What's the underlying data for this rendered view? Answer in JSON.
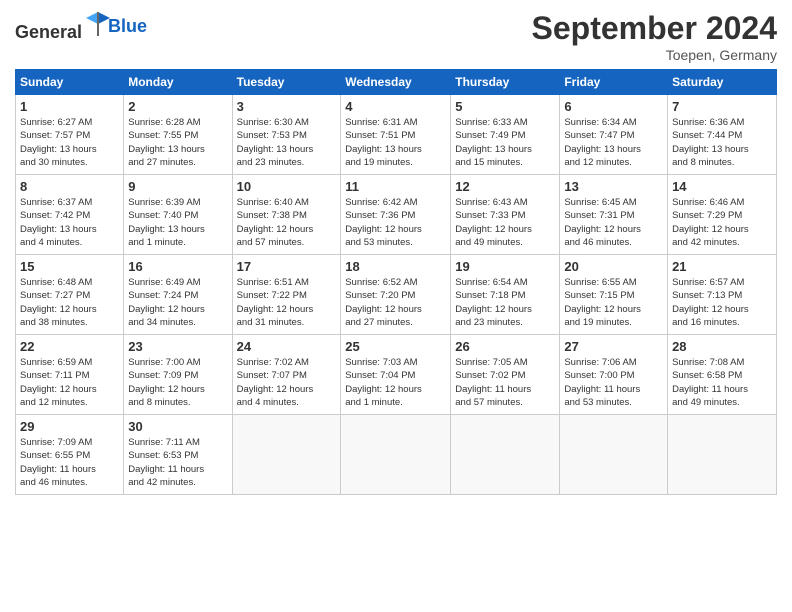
{
  "header": {
    "logo_general": "General",
    "logo_blue": "Blue",
    "title": "September 2024",
    "location": "Toepen, Germany"
  },
  "columns": [
    "Sunday",
    "Monday",
    "Tuesday",
    "Wednesday",
    "Thursday",
    "Friday",
    "Saturday"
  ],
  "weeks": [
    [
      {
        "day": "1",
        "info": "Sunrise: 6:27 AM\nSunset: 7:57 PM\nDaylight: 13 hours\nand 30 minutes."
      },
      {
        "day": "2",
        "info": "Sunrise: 6:28 AM\nSunset: 7:55 PM\nDaylight: 13 hours\nand 27 minutes."
      },
      {
        "day": "3",
        "info": "Sunrise: 6:30 AM\nSunset: 7:53 PM\nDaylight: 13 hours\nand 23 minutes."
      },
      {
        "day": "4",
        "info": "Sunrise: 6:31 AM\nSunset: 7:51 PM\nDaylight: 13 hours\nand 19 minutes."
      },
      {
        "day": "5",
        "info": "Sunrise: 6:33 AM\nSunset: 7:49 PM\nDaylight: 13 hours\nand 15 minutes."
      },
      {
        "day": "6",
        "info": "Sunrise: 6:34 AM\nSunset: 7:47 PM\nDaylight: 13 hours\nand 12 minutes."
      },
      {
        "day": "7",
        "info": "Sunrise: 6:36 AM\nSunset: 7:44 PM\nDaylight: 13 hours\nand 8 minutes."
      }
    ],
    [
      {
        "day": "8",
        "info": "Sunrise: 6:37 AM\nSunset: 7:42 PM\nDaylight: 13 hours\nand 4 minutes."
      },
      {
        "day": "9",
        "info": "Sunrise: 6:39 AM\nSunset: 7:40 PM\nDaylight: 13 hours\nand 1 minute."
      },
      {
        "day": "10",
        "info": "Sunrise: 6:40 AM\nSunset: 7:38 PM\nDaylight: 12 hours\nand 57 minutes."
      },
      {
        "day": "11",
        "info": "Sunrise: 6:42 AM\nSunset: 7:36 PM\nDaylight: 12 hours\nand 53 minutes."
      },
      {
        "day": "12",
        "info": "Sunrise: 6:43 AM\nSunset: 7:33 PM\nDaylight: 12 hours\nand 49 minutes."
      },
      {
        "day": "13",
        "info": "Sunrise: 6:45 AM\nSunset: 7:31 PM\nDaylight: 12 hours\nand 46 minutes."
      },
      {
        "day": "14",
        "info": "Sunrise: 6:46 AM\nSunset: 7:29 PM\nDaylight: 12 hours\nand 42 minutes."
      }
    ],
    [
      {
        "day": "15",
        "info": "Sunrise: 6:48 AM\nSunset: 7:27 PM\nDaylight: 12 hours\nand 38 minutes."
      },
      {
        "day": "16",
        "info": "Sunrise: 6:49 AM\nSunset: 7:24 PM\nDaylight: 12 hours\nand 34 minutes."
      },
      {
        "day": "17",
        "info": "Sunrise: 6:51 AM\nSunset: 7:22 PM\nDaylight: 12 hours\nand 31 minutes."
      },
      {
        "day": "18",
        "info": "Sunrise: 6:52 AM\nSunset: 7:20 PM\nDaylight: 12 hours\nand 27 minutes."
      },
      {
        "day": "19",
        "info": "Sunrise: 6:54 AM\nSunset: 7:18 PM\nDaylight: 12 hours\nand 23 minutes."
      },
      {
        "day": "20",
        "info": "Sunrise: 6:55 AM\nSunset: 7:15 PM\nDaylight: 12 hours\nand 19 minutes."
      },
      {
        "day": "21",
        "info": "Sunrise: 6:57 AM\nSunset: 7:13 PM\nDaylight: 12 hours\nand 16 minutes."
      }
    ],
    [
      {
        "day": "22",
        "info": "Sunrise: 6:59 AM\nSunset: 7:11 PM\nDaylight: 12 hours\nand 12 minutes."
      },
      {
        "day": "23",
        "info": "Sunrise: 7:00 AM\nSunset: 7:09 PM\nDaylight: 12 hours\nand 8 minutes."
      },
      {
        "day": "24",
        "info": "Sunrise: 7:02 AM\nSunset: 7:07 PM\nDaylight: 12 hours\nand 4 minutes."
      },
      {
        "day": "25",
        "info": "Sunrise: 7:03 AM\nSunset: 7:04 PM\nDaylight: 12 hours\nand 1 minute."
      },
      {
        "day": "26",
        "info": "Sunrise: 7:05 AM\nSunset: 7:02 PM\nDaylight: 11 hours\nand 57 minutes."
      },
      {
        "day": "27",
        "info": "Sunrise: 7:06 AM\nSunset: 7:00 PM\nDaylight: 11 hours\nand 53 minutes."
      },
      {
        "day": "28",
        "info": "Sunrise: 7:08 AM\nSunset: 6:58 PM\nDaylight: 11 hours\nand 49 minutes."
      }
    ],
    [
      {
        "day": "29",
        "info": "Sunrise: 7:09 AM\nSunset: 6:55 PM\nDaylight: 11 hours\nand 46 minutes."
      },
      {
        "day": "30",
        "info": "Sunrise: 7:11 AM\nSunset: 6:53 PM\nDaylight: 11 hours\nand 42 minutes."
      },
      null,
      null,
      null,
      null,
      null
    ]
  ]
}
